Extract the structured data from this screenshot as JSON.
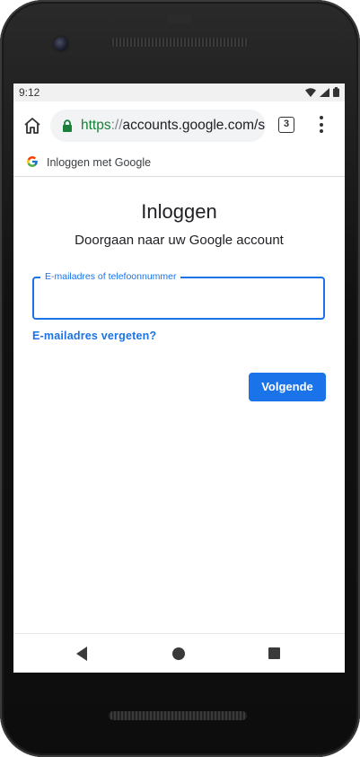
{
  "status_bar": {
    "time": "9:12",
    "icons": [
      "wifi-icon",
      "cell-signal-icon",
      "battery-icon"
    ]
  },
  "browser": {
    "url_scheme": "https",
    "url_separator": "://",
    "url_rest": "accounts.google.com/s",
    "tab_count": "3"
  },
  "signin_strip": {
    "title": "Inloggen met Google"
  },
  "page": {
    "heading": "Inloggen",
    "subheading": "Doorgaan naar uw Google account",
    "email_field": {
      "label": "E-mailadres of telefoonnummer",
      "value": ""
    },
    "forgot_link": "E-mailadres vergeten?",
    "next_button": "Volgende"
  },
  "colors": {
    "accent": "#1a73e8",
    "secure_scheme": "#188038",
    "text": "#202124"
  }
}
